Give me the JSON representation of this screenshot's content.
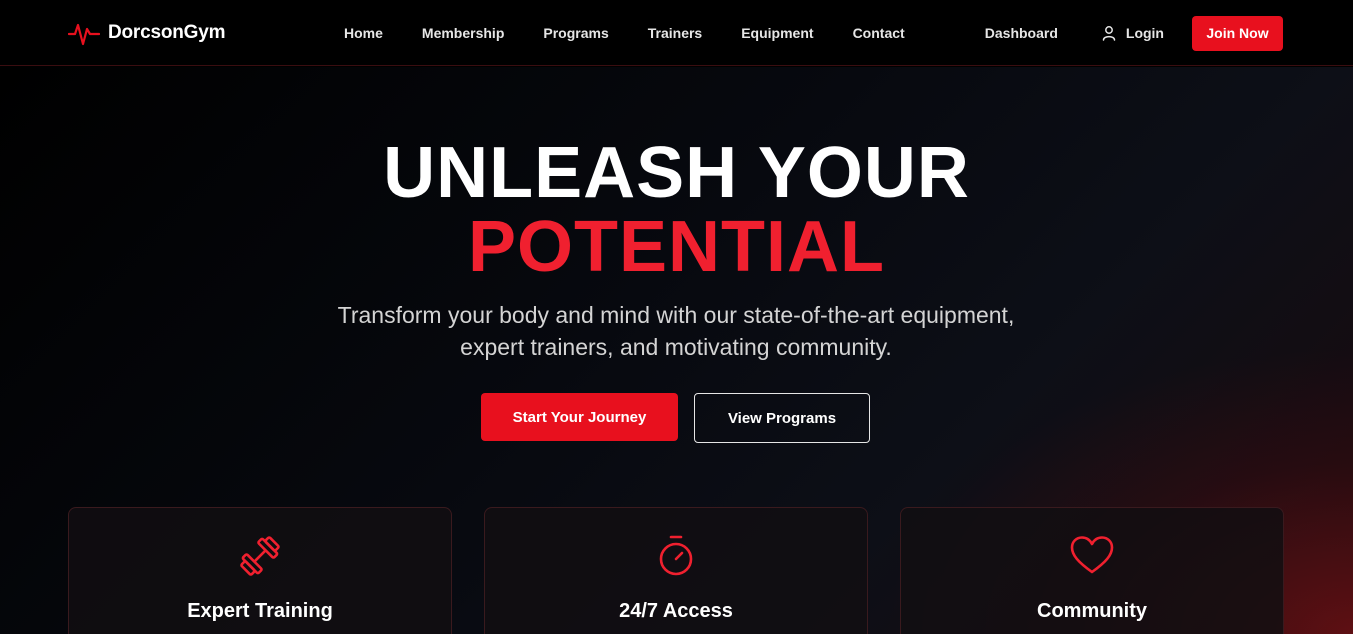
{
  "brand": {
    "name": "DorcsonGym",
    "icon": "heartbeat-icon",
    "accent": "#e8101e"
  },
  "nav": {
    "links": [
      "Home",
      "Membership",
      "Programs",
      "Trainers",
      "Equipment",
      "Contact"
    ],
    "dashboard": "Dashboard",
    "login": "Login",
    "login_icon": "user-icon",
    "join": "Join Now"
  },
  "hero": {
    "headline_1": "UNLEASH YOUR",
    "headline_2": "POTENTIAL",
    "subtitle_line_1": "Transform your body and mind with our state-of-the-art equipment,",
    "subtitle_line_2": "expert trainers, and motivating community.",
    "cta_primary": "Start Your Journey",
    "cta_secondary": "View Programs"
  },
  "features": [
    {
      "title": "Expert Training",
      "icon": "dumbbell-icon"
    },
    {
      "title": "24/7 Access",
      "icon": "stopwatch-icon"
    },
    {
      "title": "Community",
      "icon": "heart-icon"
    }
  ]
}
